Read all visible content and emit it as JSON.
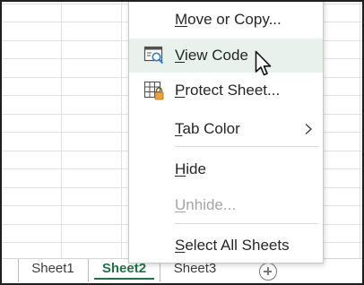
{
  "sheet_tabs": [
    {
      "label": "Sheet1",
      "active": false
    },
    {
      "label": "Sheet2",
      "active": true
    },
    {
      "label": "Sheet3",
      "active": false
    }
  ],
  "add_sheet_icon": "plus-circle-icon",
  "context_menu": {
    "items": [
      {
        "key": "M",
        "rest": "ove or Copy...",
        "icon": null,
        "disabled": false
      },
      {
        "key": "V",
        "rest": "iew Code",
        "icon": "view-code-icon",
        "hover": true,
        "disabled": false
      },
      {
        "key": "P",
        "rest": "rotect Sheet...",
        "icon": "protect-sheet-icon",
        "disabled": false
      },
      {
        "key": "T",
        "rest": "ab Color",
        "icon": null,
        "submenu": true,
        "disabled": false
      },
      {
        "key": "H",
        "rest": "ide",
        "icon": null,
        "disabled": false
      },
      {
        "key": "U",
        "rest": "nhide...",
        "icon": null,
        "disabled": true
      },
      {
        "key": "S",
        "rest": "elect All Sheets",
        "icon": null,
        "disabled": false
      }
    ]
  },
  "colors": {
    "accent": "#217346",
    "hover_bg": "#e9f1ed",
    "disabled_text": "#a6a6a6",
    "gridline": "#e1e1e1"
  }
}
